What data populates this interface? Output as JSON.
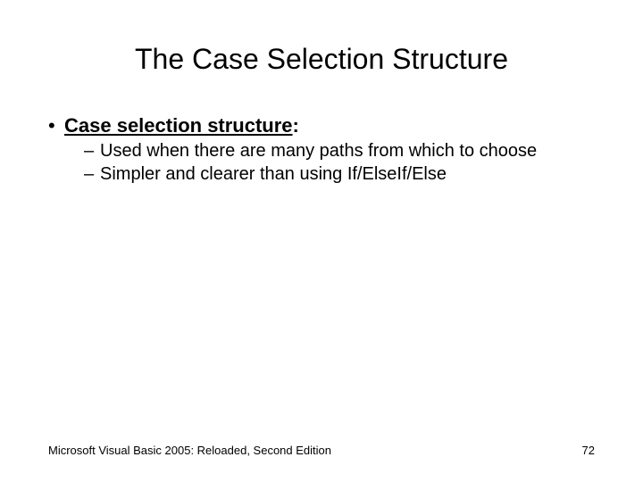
{
  "title": "The Case Selection Structure",
  "bullet1_term": "Case selection structure",
  "bullet1_colon": ":",
  "sub1": "Used when there are many paths from which to choose",
  "sub2": "Simpler and clearer than using If/ElseIf/Else",
  "footer_left": "Microsoft Visual Basic 2005: Reloaded, Second Edition",
  "footer_right": "72",
  "glyph_bullet": "•",
  "glyph_dash": "–"
}
